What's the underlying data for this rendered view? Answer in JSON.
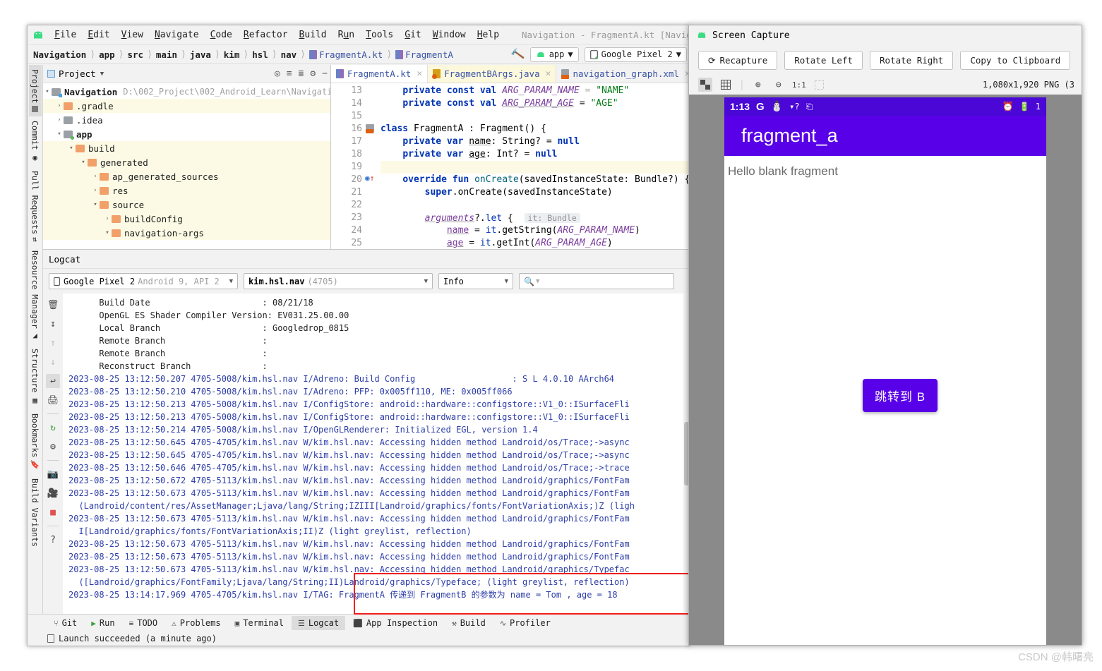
{
  "ide": {
    "menu": [
      "File",
      "Edit",
      "View",
      "Navigate",
      "Code",
      "Refactor",
      "Build",
      "Run",
      "Tools",
      "Git",
      "Window",
      "Help"
    ],
    "window_title": "Navigation - FragmentA.kt [Navigation.app.main]",
    "breadcrumb": [
      "Navigation",
      "app",
      "src",
      "main",
      "java",
      "kim",
      "hsl",
      "nav",
      "FragmentA.kt",
      "FragmentA"
    ],
    "run_config": "app",
    "device_config": "Google Pixel 2",
    "left_strip": [
      "Project",
      "Commit",
      "Pull Requests",
      "Resource Manager",
      "Structure",
      "Bookmarks",
      "Build Variants"
    ],
    "project_panel": {
      "title": "Project",
      "root_label": "Navigation",
      "root_path": "D:\\002_Project\\002_Android_Learn\\Navigati",
      "items": [
        {
          "label": ".gradle",
          "depth": 1,
          "arrow": "›",
          "color": "orange",
          "highlight": true
        },
        {
          "label": ".idea",
          "depth": 1,
          "arrow": "›",
          "color": "grey",
          "highlight": false
        },
        {
          "label": "app",
          "depth": 1,
          "arrow": "⌄",
          "color": "module",
          "highlight": false,
          "bold": true
        },
        {
          "label": "build",
          "depth": 2,
          "arrow": "⌄",
          "color": "orange",
          "highlight": true
        },
        {
          "label": "generated",
          "depth": 3,
          "arrow": "⌄",
          "color": "orange",
          "highlight": true
        },
        {
          "label": "ap_generated_sources",
          "depth": 4,
          "arrow": "›",
          "color": "orange",
          "highlight": true
        },
        {
          "label": "res",
          "depth": 4,
          "arrow": "›",
          "color": "orange",
          "highlight": true
        },
        {
          "label": "source",
          "depth": 4,
          "arrow": "⌄",
          "color": "orange",
          "highlight": true
        },
        {
          "label": "buildConfig",
          "depth": 5,
          "arrow": "›",
          "color": "orange",
          "highlight": true
        },
        {
          "label": "navigation-args",
          "depth": 5,
          "arrow": "⌄",
          "color": "orange",
          "highlight": true
        }
      ]
    },
    "editor_tabs": [
      {
        "label": "FragmentA.kt",
        "type": "kt",
        "active": true
      },
      {
        "label": "FragmentBArgs.java",
        "type": "java",
        "active": false
      },
      {
        "label": "navigation_graph.xml",
        "type": "xml",
        "active": false
      }
    ],
    "code_lines": [
      {
        "num": "13",
        "text": "    private const val ARG_PARAM_NAME = \"NAME\"",
        "clipped": true
      },
      {
        "num": "14",
        "text": "    private const val ARG_PARAM_AGE = \"AGE\""
      },
      {
        "num": "15",
        "text": ""
      },
      {
        "num": "16",
        "text": "class FragmentA : Fragment() {"
      },
      {
        "num": "17",
        "text": "    private var name: String? = null"
      },
      {
        "num": "18",
        "text": "    private var age: Int? = null"
      },
      {
        "num": "19",
        "text": "",
        "highlight": true
      },
      {
        "num": "20",
        "text": "    override fun onCreate(savedInstanceState: Bundle?) {"
      },
      {
        "num": "21",
        "text": "        super.onCreate(savedInstanceState)"
      },
      {
        "num": "22",
        "text": ""
      },
      {
        "num": "23",
        "text": "        arguments?.let {   it: Bundle"
      },
      {
        "num": "24",
        "text": "            name = it.getString(ARG_PARAM_NAME)"
      },
      {
        "num": "25",
        "text": "            age = it.getInt(ARG_PARAM_AGE)"
      }
    ],
    "logcat": {
      "title": "Logcat",
      "device": "Google Pixel 2",
      "device_detail": "Android 9, API 2",
      "process": "kim.hsl.nav",
      "process_pid": "(4705)",
      "level": "Info",
      "search_placeholder": "Q",
      "lines": [
        {
          "t": "      Build Date                      : 08/21/18",
          "c": "dark",
          "split": 32,
          "head": "      Build Date                      : ",
          "tail": "08/21/18"
        },
        {
          "t": "      OpenGL ES Shader Compiler Version: EV031.25.00.00",
          "head": "      OpenGL ES Shader Compiler Version: ",
          "tail": "EV031.25.00.00"
        },
        {
          "t": "      Local Branch                    : Googledrop_0815",
          "head": "      Local Branch                     : ",
          "tail": "Googledrop_0815"
        },
        {
          "t": "      Remote Branch                   :",
          "head": "      Remote Branch                    :",
          "tail": ""
        },
        {
          "t": "      Remote Branch                   :",
          "head": "      Remote Branch                    :",
          "tail": ""
        },
        {
          "t": "      Reconstruct Branch              :",
          "head": "      Reconstruct Branch               :",
          "tail": ""
        },
        {
          "t": "2023-08-25 13:12:50.207 4705-5008/kim.hsl.nav I/Adreno: Build Config                   : S L 4.0.10 AArch64",
          "c": "blue"
        },
        {
          "t": "2023-08-25 13:12:50.210 4705-5008/kim.hsl.nav I/Adreno: PFP: 0x005ff110, ME: 0x005ff066",
          "c": "blue"
        },
        {
          "t": "2023-08-25 13:12:50.213 4705-5008/kim.hsl.nav I/ConfigStore: android::hardware::configstore::V1_0::ISurfaceFli",
          "c": "blue"
        },
        {
          "t": "2023-08-25 13:12:50.213 4705-5008/kim.hsl.nav I/ConfigStore: android::hardware::configstore::V1_0::ISurfaceFli",
          "c": "blue"
        },
        {
          "t": "2023-08-25 13:12:50.214 4705-5008/kim.hsl.nav I/OpenGLRenderer: Initialized EGL, version 1.4",
          "c": "blue"
        },
        {
          "t": "2023-08-25 13:12:50.645 4705-4705/kim.hsl.nav W/kim.hsl.nav: Accessing hidden method Landroid/os/Trace;->async",
          "c": "blue"
        },
        {
          "t": "2023-08-25 13:12:50.645 4705-4705/kim.hsl.nav W/kim.hsl.nav: Accessing hidden method Landroid/os/Trace;->async",
          "c": "blue"
        },
        {
          "t": "2023-08-25 13:12:50.646 4705-4705/kim.hsl.nav W/kim.hsl.nav: Accessing hidden method Landroid/os/Trace;->trace",
          "c": "blue"
        },
        {
          "t": "2023-08-25 13:12:50.672 4705-5113/kim.hsl.nav W/kim.hsl.nav: Accessing hidden method Landroid/graphics/FontFam",
          "c": "blue"
        },
        {
          "t": "2023-08-25 13:12:50.673 4705-5113/kim.hsl.nav W/kim.hsl.nav: Accessing hidden method Landroid/graphics/FontFam",
          "c": "blue"
        },
        {
          "t": "  (Landroid/content/res/AssetManager;Ljava/lang/String;IZIII[Landroid/graphics/fonts/FontVariationAxis;)Z (ligh",
          "c": "blue"
        },
        {
          "t": "2023-08-25 13:12:50.673 4705-5113/kim.hsl.nav W/kim.hsl.nav: Accessing hidden method Landroid/graphics/FontFam",
          "c": "blue"
        },
        {
          "t": "  I[Landroid/graphics/fonts/FontVariationAxis;II)Z (light greylist, reflection)",
          "c": "blue"
        },
        {
          "t": "2023-08-25 13:12:50.673 4705-5113/kim.hsl.nav W/kim.hsl.nav: Accessing hidden method Landroid/graphics/FontFam",
          "c": "blue"
        },
        {
          "t": "2023-08-25 13:12:50.673 4705-5113/kim.hsl.nav W/kim.hsl.nav: Accessing hidden method Landroid/graphics/FontFam",
          "c": "blue"
        },
        {
          "t": "2023-08-25 13:12:50.673 4705-5113/kim.hsl.nav W/kim.hsl.nav: Accessing hidden method Landroid/graphics/Typefac",
          "c": "blue"
        },
        {
          "t": "  ([Landroid/graphics/FontFamily;Ljava/lang/String;II)Landroid/graphics/Typeface; (light greylist, reflection)",
          "c": "blue"
        },
        {
          "t": "2023-08-25 13:14:17.969 4705-4705/kim.hsl.nav I/TAG: FragmentA 传递到 FragmentB 的参数为 name = Tom , age = 18",
          "c": "blue"
        }
      ]
    },
    "bottom_tabs": [
      {
        "label": "Git",
        "icon": "branch-icon"
      },
      {
        "label": "Run",
        "icon": "play-icon"
      },
      {
        "label": "TODO",
        "icon": "list-icon"
      },
      {
        "label": "Problems",
        "icon": "warning-icon"
      },
      {
        "label": "Terminal",
        "icon": "terminal-icon"
      },
      {
        "label": "Logcat",
        "icon": "logcat-icon",
        "selected": true
      },
      {
        "label": "App Inspection",
        "icon": "inspect-icon"
      },
      {
        "label": "Build",
        "icon": "hammer-icon"
      },
      {
        "label": "Profiler",
        "icon": "profiler-icon"
      }
    ],
    "status_text": "Launch succeeded (a minute ago)"
  },
  "screen_capture": {
    "title": "Screen Capture",
    "buttons": [
      "Recapture",
      "Rotate Left",
      "Rotate Right",
      "Copy to Clipboard"
    ],
    "zoom_label": "1:1",
    "size_info": "1,080x1,920 PNG (3",
    "phone": {
      "status_time": "1:13",
      "status_icons": [
        "google-icon",
        "gmail-icon",
        "wifi-icon",
        "download-icon"
      ],
      "status_right_icons": [
        "alarm-icon",
        "battery-icon"
      ],
      "battery_text": "1",
      "app_bar_title": "fragment_a",
      "body_text": "Hello blank fragment",
      "button_label": "跳转到 B"
    }
  },
  "watermark": "CSDN @韩曙亮",
  "colors": {
    "accent_purple": "#5800e8",
    "status_purple": "#4a07d6",
    "highlight_red": "#f01e1e",
    "log_blue": "#2d3ea8"
  }
}
